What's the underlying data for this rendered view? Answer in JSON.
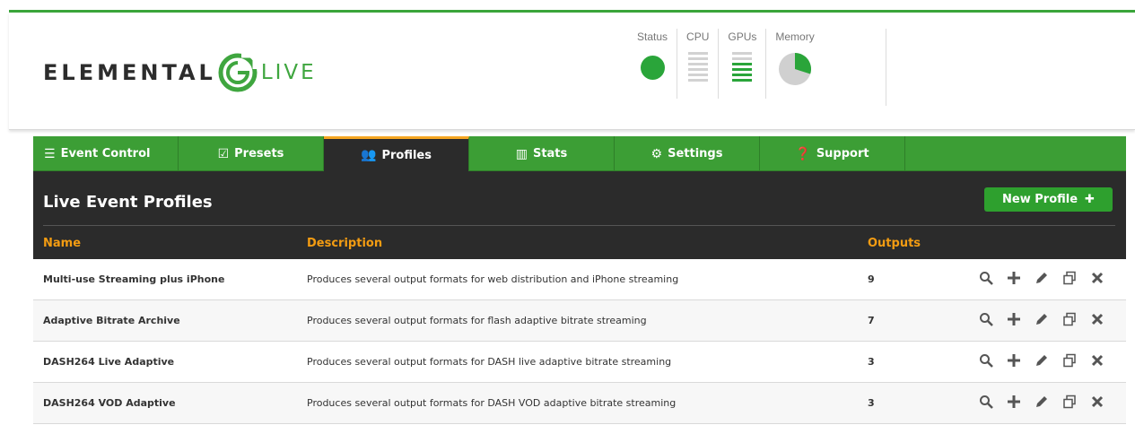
{
  "logo": {
    "left": "ELEMENTAL",
    "right": "LIVE"
  },
  "status": {
    "labels": {
      "status": "Status",
      "cpu": "CPU",
      "gpus": "GPUs",
      "memory": "Memory"
    },
    "colors": {
      "ok": "#2aa53a",
      "idle_bar": "#d2d2d2"
    },
    "memory_used_fraction": 0.3
  },
  "nav": {
    "tabs": [
      {
        "label": "Event Control",
        "icon": "list-icon"
      },
      {
        "label": "Presets",
        "icon": "checkbox-icon"
      },
      {
        "label": "Profiles",
        "icon": "users-icon",
        "active": true
      },
      {
        "label": "Stats",
        "icon": "bar-chart-icon"
      },
      {
        "label": "Settings",
        "icon": "gear-icon"
      },
      {
        "label": "Support",
        "icon": "question-icon"
      }
    ]
  },
  "panel": {
    "title": "Live Event Profiles",
    "new_button": "New Profile"
  },
  "table": {
    "headers": {
      "name": "Name",
      "description": "Description",
      "outputs": "Outputs"
    },
    "rows": [
      {
        "name": "Multi-use Streaming plus iPhone",
        "description": "Produces several output formats for web distribution and iPhone streaming",
        "outputs": "9"
      },
      {
        "name": "Adaptive Bitrate Archive",
        "description": "Produces several output formats for flash adaptive bitrate streaming",
        "outputs": "7"
      },
      {
        "name": "DASH264 Live Adaptive",
        "description": "Produces several output formats for DASH live adaptive bitrate streaming",
        "outputs": "3"
      },
      {
        "name": "DASH264 VOD Adaptive",
        "description": "Produces several output formats for DASH VOD adaptive bitrate streaming",
        "outputs": "3"
      }
    ],
    "actions": [
      "search-icon",
      "plus-icon",
      "pencil-icon",
      "copy-icon",
      "delete-icon"
    ]
  },
  "colors": {
    "brand_green": "#3c9e35",
    "dark": "#2b2b2b",
    "accent_orange": "#f39c12"
  }
}
